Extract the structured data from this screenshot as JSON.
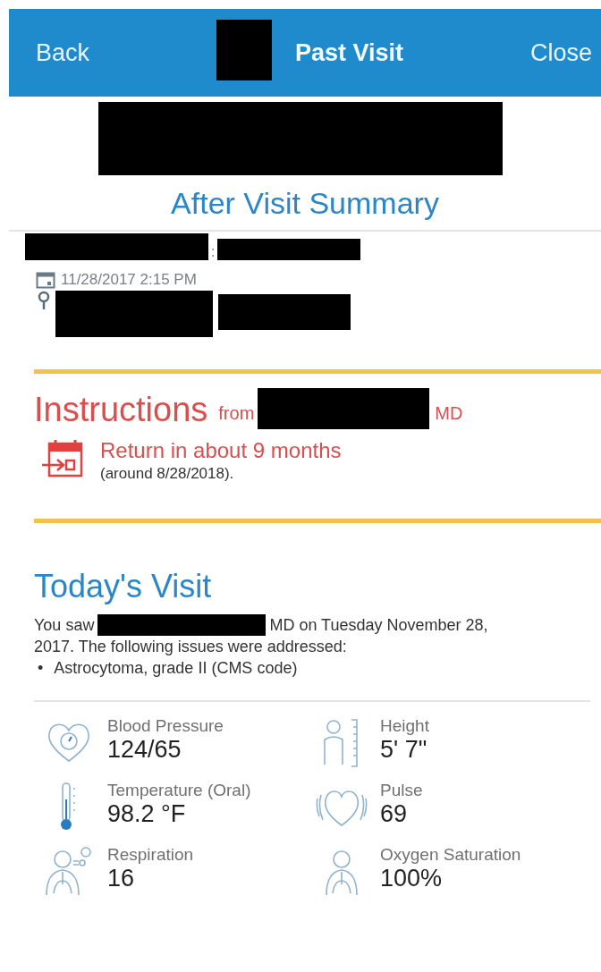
{
  "nav_bar": {
    "back": "Back",
    "title": "Past Visit",
    "close": "Close"
  },
  "summary_title": "After Visit Summary",
  "visit_info": {
    "separator": ":",
    "date_time": "11/28/2017  2:15 PM"
  },
  "instructions": {
    "heading": "Instructions",
    "from": "from",
    "suffix": "MD",
    "return_text": "Return in about 9 months",
    "return_date": "(around 8/28/2018)."
  },
  "todays_visit": {
    "heading": "Today's Visit",
    "text_before": "You saw",
    "text_after": "MD on Tuesday November 28,",
    "text_line2": "2017. The following issues were addressed:",
    "bullet": "•",
    "issues": [
      "Astrocytoma, grade II (CMS code)"
    ]
  },
  "vitals": [
    {
      "kind": "blood-pressure",
      "label": "Blood Pressure",
      "value": "124/65"
    },
    {
      "kind": "height",
      "label": "Height",
      "value": "5' 7\""
    },
    {
      "kind": "temperature",
      "label": "Temperature (Oral)",
      "value": "98.2 °F"
    },
    {
      "kind": "pulse",
      "label": "Pulse",
      "value": "69"
    },
    {
      "kind": "respiration",
      "label": "Respiration",
      "value": "16"
    },
    {
      "kind": "oxygen",
      "label": "Oxygen Saturation",
      "value": "100%"
    }
  ]
}
